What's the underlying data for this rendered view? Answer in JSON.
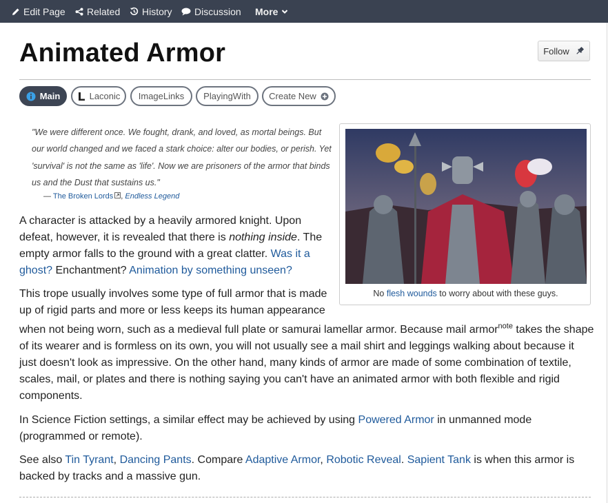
{
  "nav": {
    "edit_page": "Edit Page",
    "related": "Related",
    "history": "History",
    "discussion": "Discussion",
    "more": "More"
  },
  "page": {
    "title": "Animated Armor",
    "follow_label": "Follow"
  },
  "tabs": [
    {
      "label": "Main",
      "icon": "info-icon",
      "active": true
    },
    {
      "label": "Laconic",
      "icon": "laconic-icon",
      "active": false
    },
    {
      "label": "ImageLinks",
      "active": false
    },
    {
      "label": "PlayingWith",
      "active": false
    },
    {
      "label": "Create New",
      "icon": "plus-circle-icon",
      "active": false
    }
  ],
  "quote": {
    "text": "\"We were different once. We fought, drank, and loved, as mortal beings. But our world changed and we faced a stark choice: alter our bodies, or perish. Yet 'survival' is not the same as 'life'. Now we are prisoners of the armor that binds us and the Dust that sustains us.\"",
    "dash": "—",
    "source_link": "The Broken Lords",
    "separator": ",",
    "work_link": "Endless Legend"
  },
  "figure": {
    "caption_pre": "No",
    "caption_link": "flesh wounds",
    "caption_post": "to worry about with these guys."
  },
  "paragraph1": {
    "t1": "A character is attacked by a heavily armored knight. Upon defeat, however, it is revealed that there is",
    "em": "nothing inside",
    "t2": ". The empty armor falls to the ground with a great clatter.",
    "link1": "Was it a ghost?",
    "t3": "Enchantment?",
    "link2": "Animation by something unseen?"
  },
  "paragraph2": {
    "t1": "This trope usually involves some type of full armor that is made up of rigid parts and more or less keeps its human appearance",
    "t2": "when not being worn, such as a medieval full plate or samurai lamellar armor. Because mail armor",
    "note": "note",
    "t3": "takes the shape of its wearer and is formless on its own, you will not usually see a mail shirt and leggings walking about because it just doesn't look as impressive. On the other hand, many kinds of armor are made of some combination of textile, scales, mail, or plates and there is nothing saying you can't have an animated armor with both flexible and rigid components."
  },
  "paragraph3": {
    "t1": "In Science Fiction settings, a similar effect may be achieved by using",
    "link": "Powered Armor",
    "t2": "in unmanned mode (programmed or remote)."
  },
  "paragraph4": {
    "t1": "See also",
    "link1": "Tin Tyrant",
    "sep1": ",",
    "link2": "Dancing Pants",
    "t2": ". Compare",
    "link3": "Adaptive Armor",
    "sep2": ",",
    "link4": "Robotic Reveal",
    "sep3": ".",
    "link5": "Sapient Tank",
    "t3": "is when this armor is backed by tracks and a massive gun."
  },
  "colors": {
    "topbar": "#3a4251",
    "link": "#1f5a9b",
    "tab_active": "#3d4554",
    "info_icon": "#3aa0e6"
  }
}
